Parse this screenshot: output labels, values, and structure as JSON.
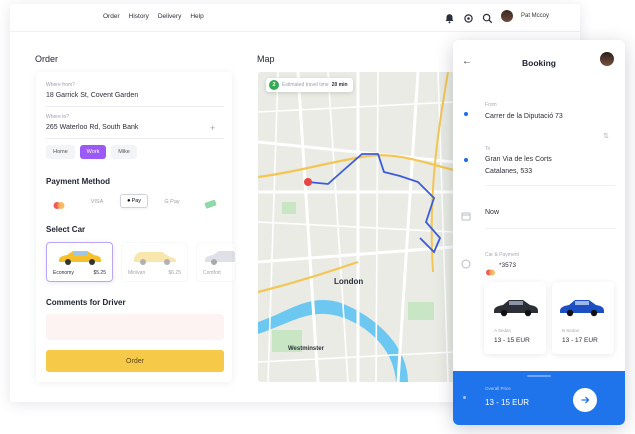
{
  "nav": {
    "links": [
      "Order",
      "History",
      "Delivery",
      "Help"
    ],
    "user_name": "Pat Mccoy"
  },
  "order": {
    "title": "Order",
    "from_label": "Where from?",
    "from_value": "18 Garrick St, Covent Garden",
    "to_label": "Where to?",
    "to_value": "265 Waterloo Rd, South Bank",
    "quick_places": [
      "Home",
      "Work",
      "Mike"
    ],
    "quick_selected": "Work",
    "payment_title": "Payment Method",
    "payment_methods": [
      "VISA",
      "Pay",
      "G Pay"
    ],
    "payment_selected": "Pay",
    "select_car_title": "Select Car",
    "cars": [
      {
        "name": "Economy",
        "price": "$5.25"
      },
      {
        "name": "Minivan",
        "price": "$6.25"
      },
      {
        "name": "Comfort",
        "price": "$6.25"
      }
    ],
    "comments_title": "Comments for Driver",
    "order_button": "Order"
  },
  "map": {
    "title": "Map",
    "eta_number": "2",
    "eta_text": "Estimated travel time",
    "eta_value": "20 min",
    "city_label": "London",
    "district_label": "Westminster"
  },
  "booking": {
    "title": "Booking",
    "from_label": "From",
    "from_value": "Carrer de la Diputació 73",
    "to_label": "To",
    "to_value_line1": "Gran Via de les Corts",
    "to_value_line2": "Catalanes, 533",
    "time_value": "Now",
    "payment_label": "Car & Payment",
    "payment_value": "*3573",
    "cars": [
      {
        "name": "A Sedan",
        "price": "13 - 15 EUR"
      },
      {
        "name": "B Sedan",
        "price": "13 - 17 EUR"
      }
    ],
    "price_label": "Overall Price",
    "price_value": "13 - 15 EUR"
  },
  "colors": {
    "accent_purple": "#9b59f5",
    "order_yellow": "#f7c948",
    "booking_blue": "#1f74ec",
    "route_blue": "#3b5bdb",
    "route_orange": "#f0b429"
  }
}
